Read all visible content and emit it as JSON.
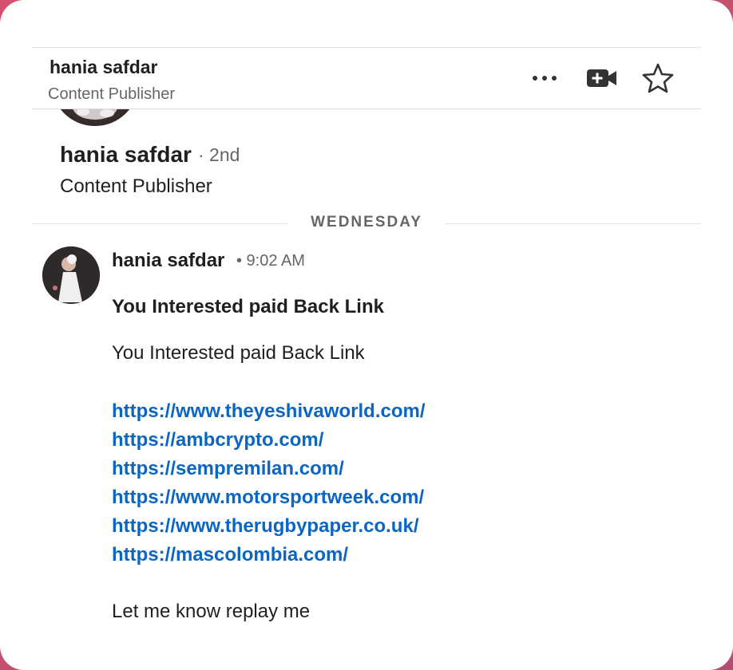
{
  "header": {
    "name": "hania safdar",
    "title": "Content Publisher",
    "icons": [
      "more-icon",
      "video-call-icon",
      "star-icon"
    ]
  },
  "profile": {
    "name": "hania safdar",
    "degree": "· 2nd",
    "title": "Content Publisher"
  },
  "divider": {
    "label": "WEDNESDAY"
  },
  "message": {
    "sender": "hania safdar",
    "time": "• 9:02 AM",
    "subject": "You Interested paid Back Link",
    "body_intro": "You Interested paid Back Link",
    "links": [
      "https://www.theyeshivaworld.com/",
      "https://ambcrypto.com/",
      "https://sempremilan.com/",
      "https://www.motorsportweek.com/",
      "https://www.therugbypaper.co.uk/",
      "https://mascolombia.com/"
    ],
    "closing": "Let me know replay me"
  },
  "colors": {
    "link": "#0a66c2",
    "text": "#1f1f1f",
    "muted": "#666666",
    "background": "#c8506d"
  }
}
